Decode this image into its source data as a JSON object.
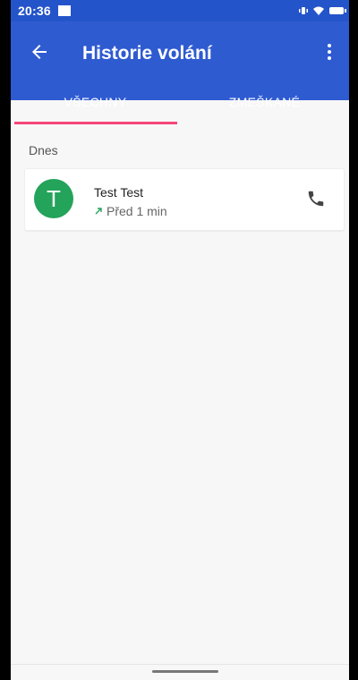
{
  "status_bar": {
    "time": "20:36"
  },
  "app_bar": {
    "title": "Historie volání"
  },
  "tabs": [
    {
      "label": "VŠECHNY",
      "selected": true
    },
    {
      "label": "ZMEŠKANÉ",
      "selected": false
    }
  ],
  "section": {
    "label": "Dnes"
  },
  "call_log": [
    {
      "avatar_letter": "T",
      "name": "Test Test",
      "time": "Před 1 min",
      "direction": "outgoing"
    }
  ],
  "colors": {
    "primary": "#2f5bd1",
    "status_bar": "#2454c9",
    "accent_indicator": "#f7477a",
    "avatar_green": "#24a35a",
    "outgoing_arrow_green": "#24a35a"
  },
  "icons": {
    "back": "arrow-left-icon",
    "more": "more-vert-icon",
    "call": "phone-icon",
    "outgoing": "outgoing-arrow-icon"
  }
}
